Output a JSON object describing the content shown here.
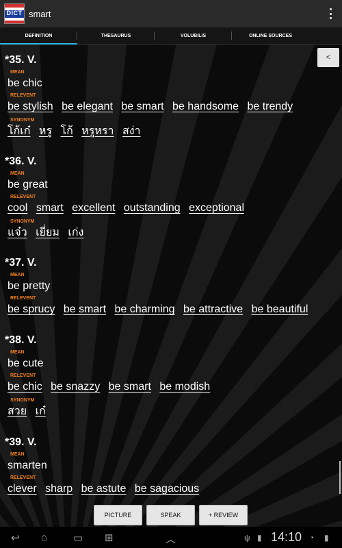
{
  "app": {
    "logo_text": "DICT",
    "title": "smart"
  },
  "tabs": [
    {
      "label": "DEFINITION",
      "active": true
    },
    {
      "label": "THESAURUS",
      "active": false
    },
    {
      "label": "VOLUBILIS",
      "active": false
    },
    {
      "label": "ONLINE SOURCES",
      "active": false
    }
  ],
  "back_button": "<",
  "labels": {
    "mean": "MEAN",
    "relevent": "RELEVENT",
    "synonym": "SYNONYM"
  },
  "entries": [
    {
      "title": "*35. V.",
      "mean": "be chic",
      "relevent": [
        "be stylish",
        "be elegant",
        "be smart",
        "be handsome",
        "be trendy"
      ],
      "synonym": [
        "โก้เก๋",
        "หรู",
        "โก้",
        "หรูหรา",
        "สง่า"
      ]
    },
    {
      "title": "*36. V.",
      "mean": "be great",
      "relevent": [
        "cool",
        "smart",
        "excellent",
        "outstanding",
        "exceptional"
      ],
      "synonym": [
        "แจ๋ว",
        "เยี่ยม",
        "เก่ง"
      ]
    },
    {
      "title": "*37. V.",
      "mean": "be pretty",
      "relevent": [
        "be sprucy",
        "be smart",
        "be charming",
        "be attractive",
        "be beautiful"
      ]
    },
    {
      "title": "*38. V.",
      "mean": "be cute",
      "relevent": [
        "be chic",
        "be snazzy",
        "be smart",
        "be modish"
      ],
      "synonym": [
        "สวย",
        "เก๋"
      ]
    },
    {
      "title": "*39. V.",
      "mean": "smarten",
      "relevent": [
        "clever",
        "sharp",
        "be astute",
        "be sagacious"
      ]
    }
  ],
  "buttons": {
    "picture": "PICTURE",
    "speak": "SPEAK",
    "review": "+ REVIEW"
  },
  "status": {
    "time": "14:10"
  },
  "colors": {
    "accent": "#33b5e5",
    "label": "#f0801f"
  }
}
